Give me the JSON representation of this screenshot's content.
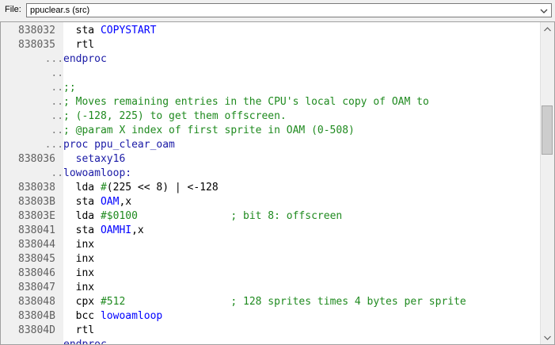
{
  "file_bar": {
    "label": "File:",
    "selected": "ppuclear.s (src)",
    "dropdown_icon": "chevron-down-icon"
  },
  "code_lines": [
    {
      "addr": "838032",
      "dots": "",
      "parts": [
        {
          "t": "  sta ",
          "c": ""
        },
        {
          "t": "COPYSTART",
          "c": "c-blue"
        }
      ]
    },
    {
      "addr": "838035",
      "dots": "",
      "parts": [
        {
          "t": "  rtl",
          "c": ""
        }
      ]
    },
    {
      "addr": "",
      "dots": "...",
      "parts": [
        {
          "t": "endproc",
          "c": "c-navy"
        }
      ]
    },
    {
      "addr": "",
      "dots": "..",
      "parts": []
    },
    {
      "addr": "",
      "dots": "..",
      "parts": [
        {
          "t": ";;",
          "c": "c-green"
        }
      ]
    },
    {
      "addr": "",
      "dots": "..",
      "parts": [
        {
          "t": "; Moves remaining entries in the CPU's local copy of OAM to",
          "c": "c-green"
        }
      ]
    },
    {
      "addr": "",
      "dots": "..",
      "parts": [
        {
          "t": "; (-128, 225) to get them offscreen.",
          "c": "c-green"
        }
      ]
    },
    {
      "addr": "",
      "dots": "..",
      "parts": [
        {
          "t": "; @param X index of first sprite in OAM (0-508)",
          "c": "c-green"
        }
      ]
    },
    {
      "addr": "",
      "dots": "...",
      "parts": [
        {
          "t": "proc ppu_clear_oam",
          "c": "c-navy"
        }
      ]
    },
    {
      "addr": "838036",
      "dots": "",
      "parts": [
        {
          "t": "  setaxy16",
          "c": "c-navy"
        }
      ]
    },
    {
      "addr": "",
      "dots": "..",
      "parts": [
        {
          "t": "lowoamloop:",
          "c": "c-navy"
        }
      ]
    },
    {
      "addr": "838038",
      "dots": "",
      "parts": [
        {
          "t": "  lda ",
          "c": ""
        },
        {
          "t": "#",
          "c": "c-green"
        },
        {
          "t": "(225 << 8) | <-128",
          "c": ""
        }
      ]
    },
    {
      "addr": "83803B",
      "dots": "",
      "parts": [
        {
          "t": "  sta ",
          "c": ""
        },
        {
          "t": "OAM",
          "c": "c-blue"
        },
        {
          "t": ",x",
          "c": ""
        }
      ]
    },
    {
      "addr": "83803E",
      "dots": "",
      "parts": [
        {
          "t": "  lda ",
          "c": ""
        },
        {
          "t": "#$0100",
          "c": "c-green"
        },
        {
          "t": "               ",
          "c": ""
        },
        {
          "t": "; bit 8: offscreen",
          "c": "c-green"
        }
      ]
    },
    {
      "addr": "838041",
      "dots": "",
      "parts": [
        {
          "t": "  sta ",
          "c": ""
        },
        {
          "t": "OAMHI",
          "c": "c-blue"
        },
        {
          "t": ",x",
          "c": ""
        }
      ]
    },
    {
      "addr": "838044",
      "dots": "",
      "parts": [
        {
          "t": "  inx",
          "c": ""
        }
      ]
    },
    {
      "addr": "838045",
      "dots": "",
      "parts": [
        {
          "t": "  inx",
          "c": ""
        }
      ]
    },
    {
      "addr": "838046",
      "dots": "",
      "parts": [
        {
          "t": "  inx",
          "c": ""
        }
      ]
    },
    {
      "addr": "838047",
      "dots": "",
      "parts": [
        {
          "t": "  inx",
          "c": ""
        }
      ]
    },
    {
      "addr": "838048",
      "dots": "",
      "parts": [
        {
          "t": "  cpx ",
          "c": ""
        },
        {
          "t": "#512",
          "c": "c-green"
        },
        {
          "t": "                 ",
          "c": ""
        },
        {
          "t": "; 128 sprites times 4 bytes per sprite",
          "c": "c-green"
        }
      ]
    },
    {
      "addr": "83804B",
      "dots": "",
      "parts": [
        {
          "t": "  bcc ",
          "c": ""
        },
        {
          "t": "lowoamloop",
          "c": "c-blue"
        }
      ]
    },
    {
      "addr": "83804D",
      "dots": "",
      "parts": [
        {
          "t": "  rtl",
          "c": ""
        }
      ]
    },
    {
      "addr": "",
      "dots": "...",
      "parts": [
        {
          "t": "endproc",
          "c": "c-navy"
        }
      ]
    }
  ],
  "scrollbar": {
    "up_icon": "scroll-up-arrow-icon",
    "down_icon": "scroll-down-arrow-icon"
  }
}
